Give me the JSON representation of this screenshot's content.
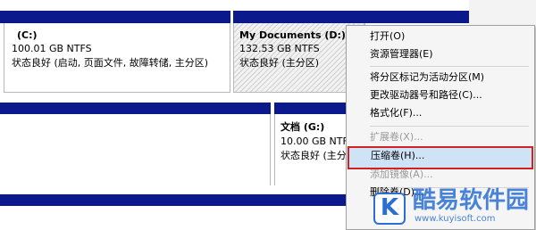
{
  "volumes_top": [
    {
      "name": "(C:)",
      "capacity": "100.01 GB NTFS",
      "status": "状态良好 (启动, 页面文件, 故障转储, 主分区)"
    },
    {
      "name": "My Documents  (D:)",
      "capacity": "132.53 GB NTFS",
      "status": "状态良好 (主分区)"
    }
  ],
  "volume_bottom": {
    "name": "文档  (G:)",
    "capacity": "10.00 GB NTFS",
    "status": "状态良好 (主分区)"
  },
  "context_menu": {
    "items": [
      {
        "label": "打开(O)",
        "disabled": false
      },
      {
        "label": "资源管理器(E)",
        "disabled": false
      },
      {
        "label": "将分区标记为活动分区(M)",
        "disabled": false
      },
      {
        "label": "更改驱动器号和路径(C)...",
        "disabled": false
      },
      {
        "label": "格式化(F)...",
        "disabled": false
      },
      {
        "label": "扩展卷(X)...",
        "disabled": true
      },
      {
        "label": "压缩卷(H)...",
        "disabled": false,
        "highlighted": true
      },
      {
        "label": "添加镜像(A)...",
        "disabled": true
      },
      {
        "label": "删除卷(D)...",
        "disabled": false
      }
    ]
  },
  "watermark": {
    "logo_letter": "K",
    "text": "酷易软件园",
    "url": "www.kuyisoft.com"
  },
  "colors": {
    "volume_bar": "#0a1a8c",
    "highlight_border": "#d42020",
    "highlight_fill": "#cfe3f7",
    "watermark": "#2a6fd1"
  }
}
